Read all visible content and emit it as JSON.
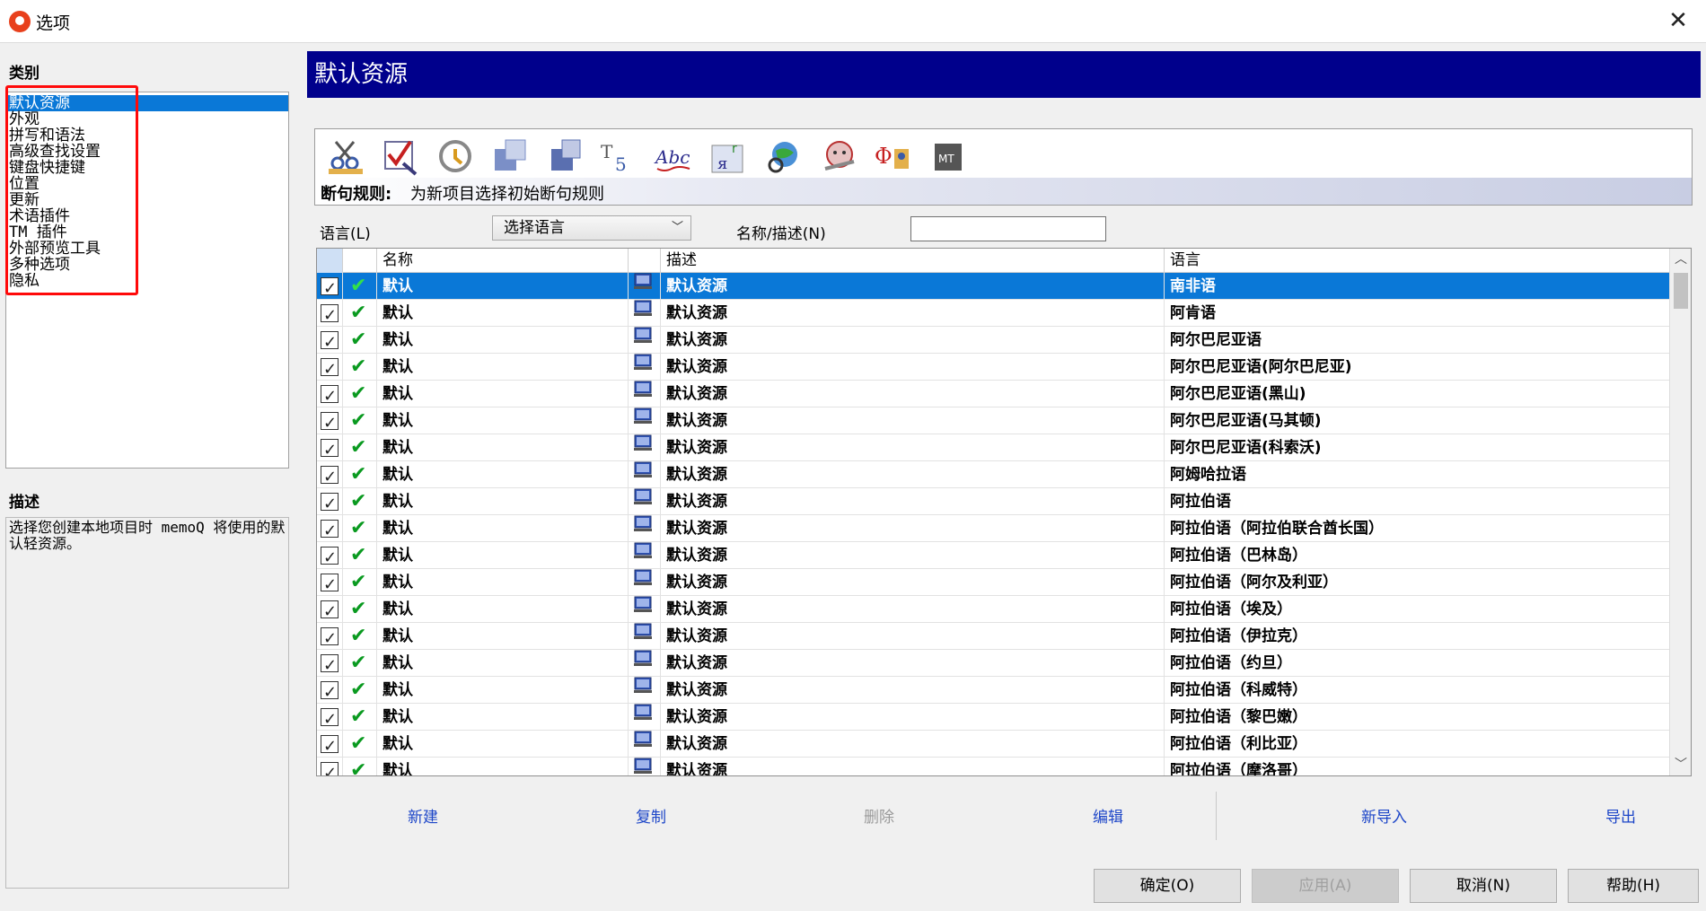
{
  "window": {
    "title": "选项",
    "close_glyph": "✕"
  },
  "categories": {
    "heading": "类别",
    "items": [
      "默认资源",
      "外观",
      "拼写和语法",
      "高级查找设置",
      "键盘快捷键",
      "位置",
      "更新",
      "术语插件",
      "TM 插件",
      "外部预览工具",
      "多种选项",
      "隐私"
    ],
    "selected_index": 0
  },
  "description": {
    "heading": "描述",
    "text": "选择您创建本地项目时 memoQ 将使用的默认轻资源。"
  },
  "header": {
    "title": "默认资源"
  },
  "toolbar": {
    "icons": [
      "segmentation-rules-icon",
      "qa-settings-icon",
      "auto-translation-rules-icon",
      "ignore-list-icon",
      "filter-config-icon",
      "font-substitution-icon",
      "spelling-icon",
      "keyboard-shortcuts-icon",
      "web-search-icon",
      "livedocs-settings-icon",
      "non-translatable-icon",
      "mt-settings-icon"
    ],
    "active_label": "断句规则:",
    "active_desc": "为新项目选择初始断句规则"
  },
  "filter": {
    "language_label": "语言(L)",
    "language_value": "选择语言",
    "name_desc_label": "名称/描述(N)",
    "name_desc_value": ""
  },
  "grid": {
    "columns": {
      "name": "名称",
      "desc": "描述",
      "lang": "语言"
    },
    "rows": [
      {
        "name": "默认",
        "desc": "默认资源",
        "lang": "南非语"
      },
      {
        "name": "默认",
        "desc": "默认资源",
        "lang": "阿肯语"
      },
      {
        "name": "默认",
        "desc": "默认资源",
        "lang": "阿尔巴尼亚语"
      },
      {
        "name": "默认",
        "desc": "默认资源",
        "lang": "阿尔巴尼亚语(阿尔巴尼亚)"
      },
      {
        "name": "默认",
        "desc": "默认资源",
        "lang": "阿尔巴尼亚语(黑山)"
      },
      {
        "name": "默认",
        "desc": "默认资源",
        "lang": "阿尔巴尼亚语(马其顿)"
      },
      {
        "name": "默认",
        "desc": "默认资源",
        "lang": "阿尔巴尼亚语(科索沃)"
      },
      {
        "name": "默认",
        "desc": "默认资源",
        "lang": "阿姆哈拉语"
      },
      {
        "name": "默认",
        "desc": "默认资源",
        "lang": "阿拉伯语"
      },
      {
        "name": "默认",
        "desc": "默认资源",
        "lang": "阿拉伯语（阿拉伯联合酋长国）"
      },
      {
        "name": "默认",
        "desc": "默认资源",
        "lang": "阿拉伯语（巴林岛）"
      },
      {
        "name": "默认",
        "desc": "默认资源",
        "lang": "阿拉伯语（阿尔及利亚）"
      },
      {
        "name": "默认",
        "desc": "默认资源",
        "lang": "阿拉伯语（埃及）"
      },
      {
        "name": "默认",
        "desc": "默认资源",
        "lang": "阿拉伯语（伊拉克）"
      },
      {
        "name": "默认",
        "desc": "默认资源",
        "lang": "阿拉伯语（约旦）"
      },
      {
        "name": "默认",
        "desc": "默认资源",
        "lang": "阿拉伯语（科威特）"
      },
      {
        "name": "默认",
        "desc": "默认资源",
        "lang": "阿拉伯语（黎巴嫩）"
      },
      {
        "name": "默认",
        "desc": "默认资源",
        "lang": "阿拉伯语（利比亚）"
      },
      {
        "name": "默认",
        "desc": "默认资源",
        "lang": "阿拉伯语（摩洛哥）"
      }
    ],
    "selected_index": 0
  },
  "actions": {
    "new": "新建",
    "clone": "复制",
    "delete": "删除",
    "edit": "编辑",
    "import_new": "新导入",
    "export": "导出"
  },
  "buttons": {
    "ok": "确定(O)",
    "apply": "应用(A)",
    "cancel": "取消(N)",
    "help": "帮助(H)"
  },
  "colors": {
    "header_bg": "#00008c",
    "selection": "#0a78d7",
    "highlight_box": "#ff0a0a",
    "tick_green": "#0a9a20",
    "link_blue": "#1d46c8"
  }
}
